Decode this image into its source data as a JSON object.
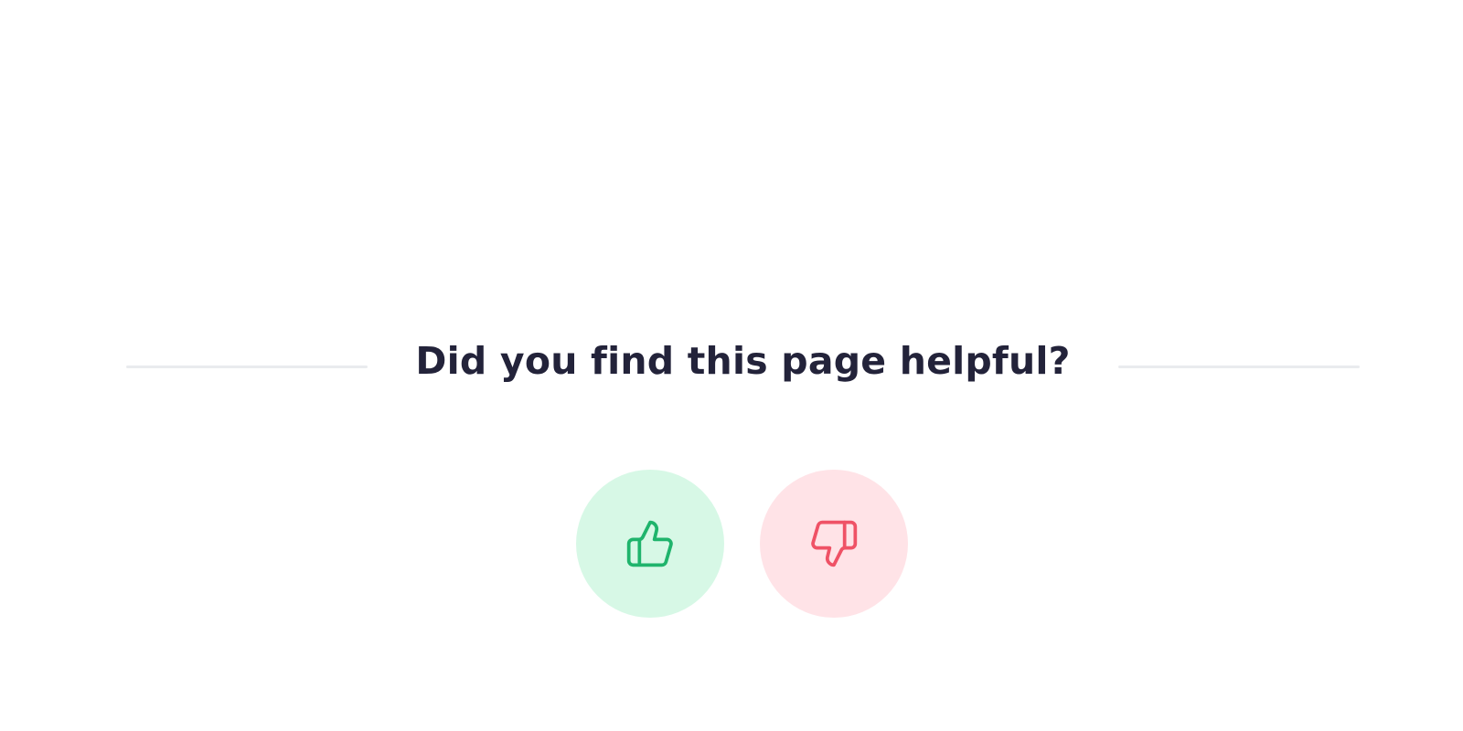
{
  "feedback": {
    "question": "Did you find this page helpful?",
    "thumbs_up": {
      "icon": "thumbs-up-icon",
      "color": "#1fb46c",
      "background": "#d7f8e6"
    },
    "thumbs_down": {
      "icon": "thumbs-down-icon",
      "color": "#ef5266",
      "background": "#ffe3e7"
    }
  },
  "colors": {
    "text": "#23233a",
    "divider": "#e9ebee",
    "page_background": "#ffffff"
  }
}
